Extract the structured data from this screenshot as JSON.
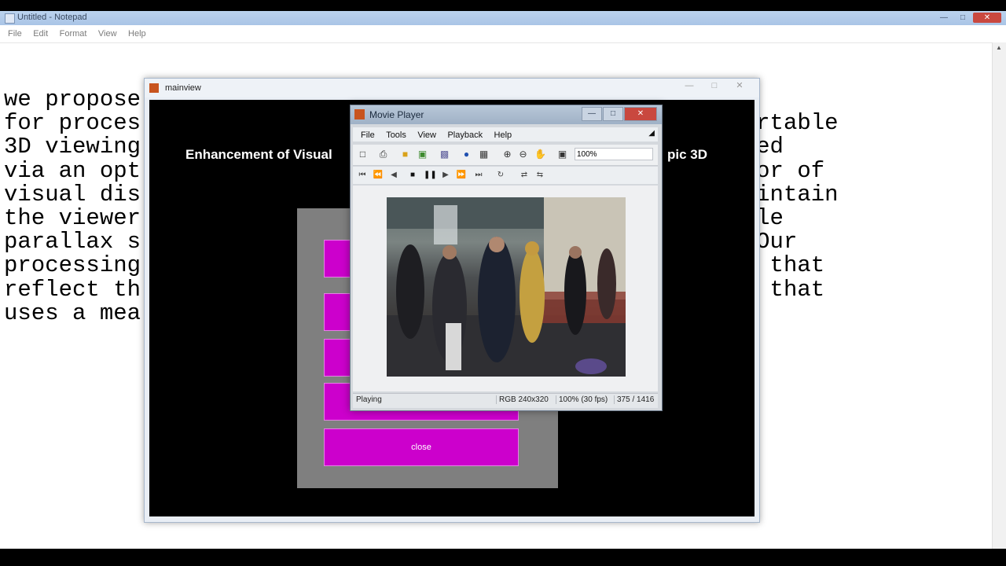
{
  "notepad": {
    "title": "Untitled - Notepad",
    "menu": [
      "File",
      "Edit",
      "Format",
      "View",
      "Help"
    ],
    "text_lines": [
      "we propose                                      h",
      "for proces                                        comfortable",
      "3D viewing                                        plished",
      "via an opt                                        dicator of",
      "visual dis                                        to maintain",
      "the viewer                                        uitable",
      "parallax s                                        nal. Our",
      "processing                                        nates that",
      "reflect th                                        s and that",
      "uses a mea"
    ]
  },
  "mainview": {
    "title": "mainview",
    "heading_left": "Enhancement of Visual",
    "heading_right": "pic 3D",
    "close_button": "close"
  },
  "movie_player": {
    "title": "Movie Player",
    "menu": [
      "File",
      "Tools",
      "View",
      "Playback",
      "Help"
    ],
    "zoom": "100%",
    "status": {
      "state": "Playing",
      "resolution": "RGB 240x320",
      "rate": "100% (30 fps)",
      "frame": "375 / 1416"
    }
  },
  "colors": {
    "button_magenta": "#cc00cc",
    "panel_gray": "#7f7f7f"
  }
}
